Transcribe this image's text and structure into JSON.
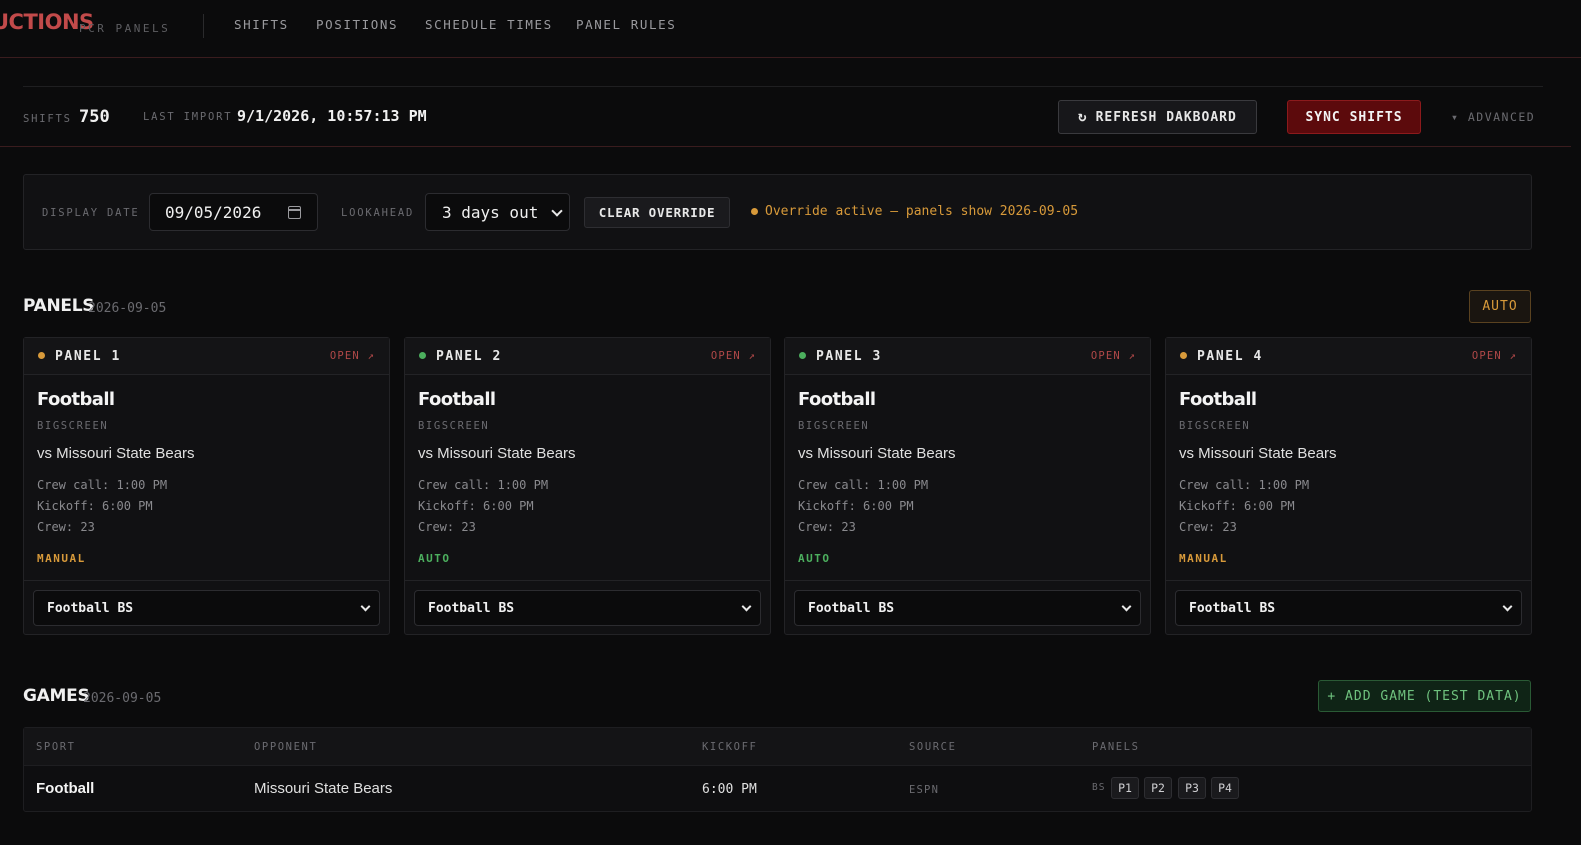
{
  "nav": {
    "brand": "UCTIONS",
    "brand_sub": "PCR PANELS",
    "items": [
      {
        "label": "SHIFTS"
      },
      {
        "label": "POSITIONS"
      },
      {
        "label": "SCHEDULE TIMES"
      },
      {
        "label": "PANEL RULES"
      }
    ]
  },
  "stats": {
    "shifts_label": "SHIFTS",
    "shifts_value": "750",
    "import_label": "LAST IMPORT",
    "import_value": "9/1/2026, 10:57:13 PM",
    "refresh_icon": "refresh-icon",
    "refresh_label": "REFRESH DAKBOARD",
    "sync_label": "SYNC SHIFTS",
    "advanced_label": "▾ ADVANCED"
  },
  "override": {
    "date_label": "DISPLAY DATE",
    "date_value": "09/05/2026",
    "lookahead_label": "LOOKAHEAD",
    "lookahead_value": "3 days out",
    "clear_label": "CLEAR OVERRIDE",
    "status_text": "Override active — panels show 2026-09-05",
    "status_color": "#d89a3a"
  },
  "panels_section": {
    "title": "PANELS",
    "date": "2026-09-05",
    "auto_label": "AUTO"
  },
  "panels": [
    {
      "name": "PANEL 1",
      "dot_color": "#d89a3a",
      "open": "OPEN ↗",
      "sport": "Football",
      "venue": "BIGSCREEN",
      "opponent": "vs Missouri State Bears",
      "crew_call": "Crew call: 1:00 PM",
      "kickoff": "Kickoff: 6:00 PM",
      "crew": "Crew: 23",
      "mode": "MANUAL",
      "mode_color": "#d89a3a",
      "select": "Football BS"
    },
    {
      "name": "PANEL 2",
      "dot_color": "#4caf5e",
      "open": "OPEN ↗",
      "sport": "Football",
      "venue": "BIGSCREEN",
      "opponent": "vs Missouri State Bears",
      "crew_call": "Crew call: 1:00 PM",
      "kickoff": "Kickoff: 6:00 PM",
      "crew": "Crew: 23",
      "mode": "AUTO",
      "mode_color": "#4caf5e",
      "select": "Football BS"
    },
    {
      "name": "PANEL 3",
      "dot_color": "#4caf5e",
      "open": "OPEN ↗",
      "sport": "Football",
      "venue": "BIGSCREEN",
      "opponent": "vs Missouri State Bears",
      "crew_call": "Crew call: 1:00 PM",
      "kickoff": "Kickoff: 6:00 PM",
      "crew": "Crew: 23",
      "mode": "AUTO",
      "mode_color": "#4caf5e",
      "select": "Football BS"
    },
    {
      "name": "PANEL 4",
      "dot_color": "#d89a3a",
      "open": "OPEN ↗",
      "sport": "Football",
      "venue": "BIGSCREEN",
      "opponent": "vs Missouri State Bears",
      "crew_call": "Crew call: 1:00 PM",
      "kickoff": "Kickoff: 6:00 PM",
      "crew": "Crew: 23",
      "mode": "MANUAL",
      "mode_color": "#d89a3a",
      "select": "Football BS"
    }
  ],
  "games_section": {
    "title": "GAMES",
    "date": "2026-09-05",
    "add_label": "+ ADD GAME (TEST DATA)"
  },
  "games_table": {
    "headers": [
      "SPORT",
      "OPPONENT",
      "KICKOFF",
      "SOURCE",
      "PANELS"
    ],
    "rows": [
      {
        "sport": "Football",
        "opponent": "Missouri State Bears",
        "kickoff": "6:00 PM",
        "source": "ESPN",
        "panel_group": "BS",
        "panels": [
          "P1",
          "P2",
          "P3",
          "P4"
        ]
      }
    ]
  }
}
